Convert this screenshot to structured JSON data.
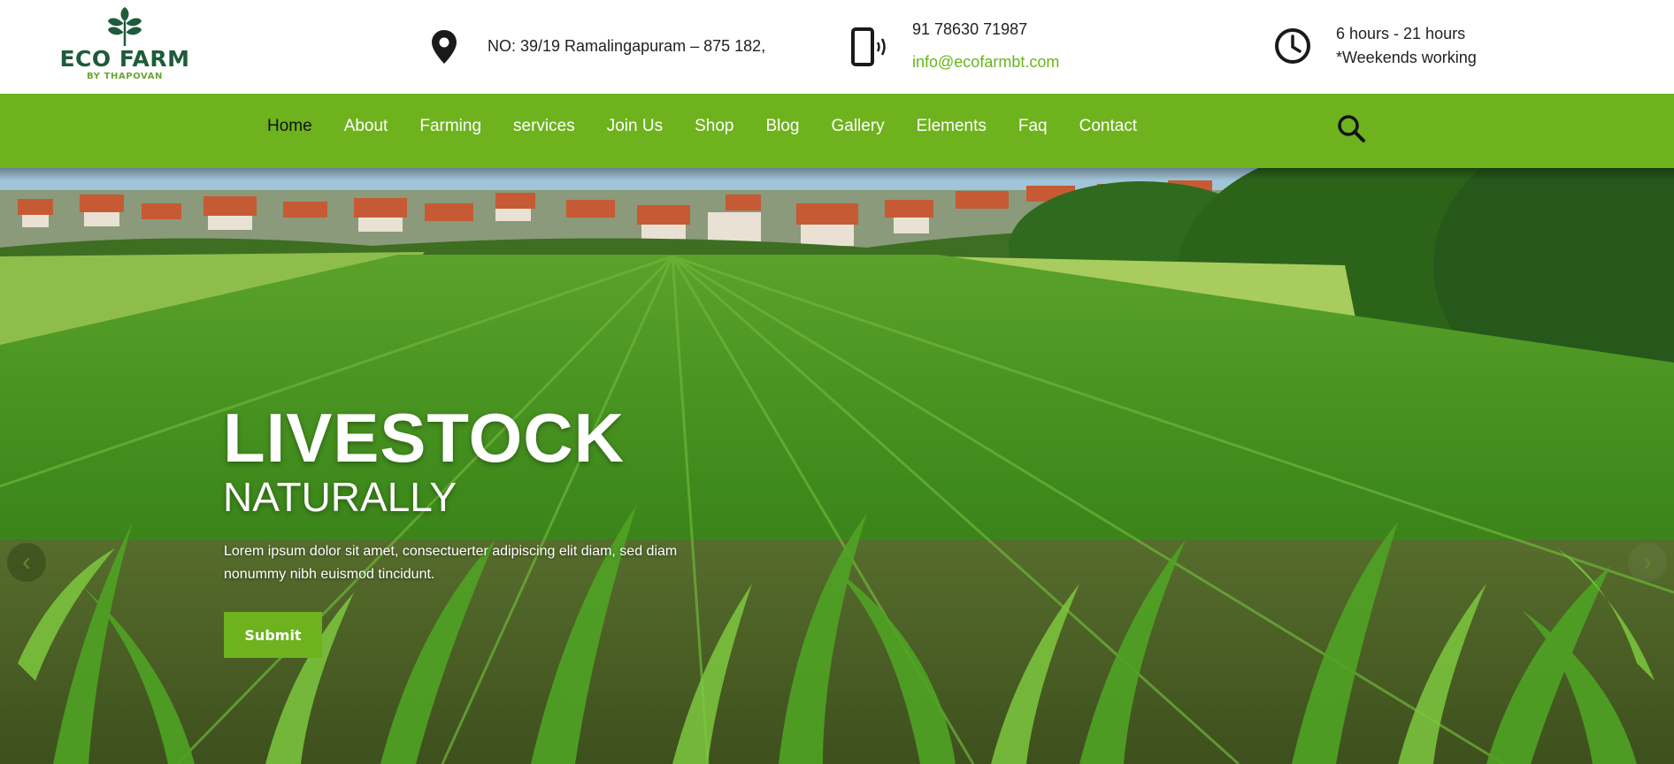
{
  "brand": {
    "name": "ECO FARM",
    "tagline": "BY THAPOVAN"
  },
  "contact": {
    "address": "NO: 39/19 Ramalingapuram – 875 182,",
    "phone": "91 78630 71987",
    "email": "info@ecofarmbt.com",
    "hours": "6 hours - 21 hours",
    "days": "*Weekends working",
    "icons": [
      "location-pin-icon",
      "mobile-phone-icon",
      "clock-icon"
    ]
  },
  "nav": {
    "items": [
      "Home",
      "About",
      "Farming",
      "services",
      "Join Us",
      "Shop",
      "Blog",
      "Gallery",
      "Elements",
      "Faq",
      "Contact"
    ],
    "active": "Home",
    "search_icon": "search-icon"
  },
  "hero": {
    "title": "LIVESTOCK",
    "subtitle": "NATURALLY",
    "text": "Lorem ipsum dolor sit amet, consectuerter adipiscing elit diam, sed diam nonummy nibh euismod tincidunt.",
    "button": "Submit",
    "prev_label": "‹",
    "next_label": "›"
  },
  "colors": {
    "accent": "#6eb31d",
    "brand_dark": "#1e5b3a",
    "link_green": "#6ab41e"
  }
}
